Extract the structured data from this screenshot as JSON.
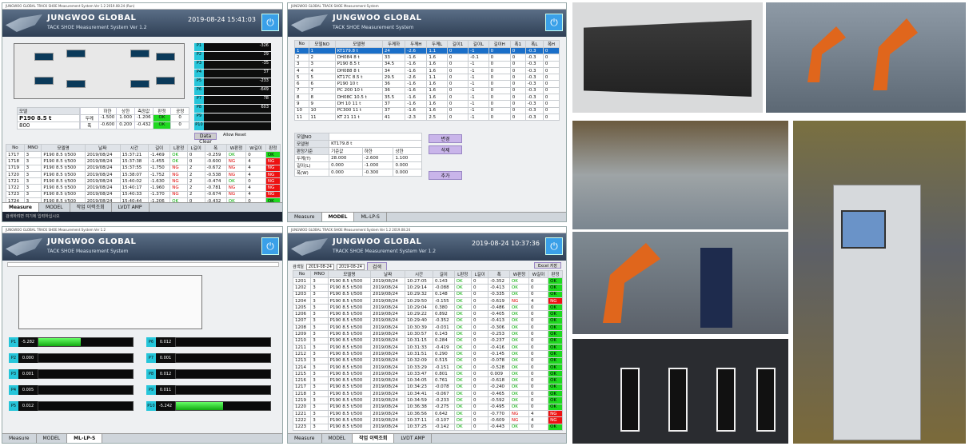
{
  "panel1": {
    "titlebar": "JUNGWOO GLOBAL TRACK SHOE Measurement System Ver 1.2 2019.08.24 (Run)",
    "company": "JUNGWOO GLOBAL",
    "system": "TACK SHOE Measurement System",
    "version": "Ver 1.2",
    "timestamp": "2019-08-24 15:41:03",
    "sensors": [
      {
        "name": "P1",
        "value": "-326"
      },
      {
        "name": "P2",
        "value": "29"
      },
      {
        "name": "P3",
        "value": "-35"
      },
      {
        "name": "P4",
        "value": "37"
      },
      {
        "name": "P5",
        "value": "-233"
      },
      {
        "name": "P6",
        "value": "-649"
      },
      {
        "name": "P7",
        "value": "78"
      },
      {
        "name": "P8",
        "value": "603"
      },
      {
        "name": "P9",
        "value": ""
      },
      {
        "name": "P10",
        "value": ""
      }
    ],
    "model_label": "모델",
    "model": "P190 8.5 t",
    "model_sub": "800",
    "spec_headers": [
      "",
      "하한",
      "상한",
      "측정값",
      "판정",
      "공정"
    ],
    "spec_rows": [
      [
        "두께",
        "-1.500",
        "1.000",
        "-1.206",
        "OK",
        "0"
      ],
      [
        "폭",
        "-0.600",
        "0.200",
        "-0.432",
        "OK",
        "0"
      ]
    ],
    "buttons": [
      "Data Clear",
      "Allow Reset"
    ],
    "headers": [
      "No",
      "MNO",
      "모델명",
      "날짜",
      "시간",
      "길이",
      "L판정",
      "L길이",
      "폭",
      "W판정",
      "W길이",
      "판정"
    ],
    "rows": [
      [
        "1717",
        "3",
        "P190 8.5 t/500",
        "2019/08/24",
        "15:37:21",
        "-1.469",
        "OK",
        "0",
        "-0.259",
        "OK",
        "0",
        "OK"
      ],
      [
        "1718",
        "3",
        "P190 8.5 t/500",
        "2019/08/24",
        "15:37:38",
        "-1.455",
        "OK",
        "0",
        "-0.600",
        "NG",
        "4",
        "NG"
      ],
      [
        "1719",
        "3",
        "P190 8.5 t/500",
        "2019/08/24",
        "15:37:55",
        "-1.750",
        "NG",
        "2",
        "-0.672",
        "NG",
        "4",
        "NG"
      ],
      [
        "1720",
        "3",
        "P190 8.5 t/500",
        "2019/08/24",
        "15:38:07",
        "-1.752",
        "NG",
        "2",
        "-0.538",
        "NG",
        "4",
        "NG"
      ],
      [
        "1721",
        "3",
        "P190 8.5 t/500",
        "2019/08/24",
        "15:40:02",
        "-1.630",
        "NG",
        "2",
        "-0.474",
        "OK",
        "0",
        "NG"
      ],
      [
        "1722",
        "3",
        "P190 8.5 t/500",
        "2019/08/24",
        "15:40:17",
        "-1.960",
        "NG",
        "2",
        "-0.781",
        "NG",
        "4",
        "NG"
      ],
      [
        "1723",
        "3",
        "P190 8.5 t/500",
        "2019/08/24",
        "15:40:33",
        "-1.370",
        "NG",
        "2",
        "-0.674",
        "NG",
        "4",
        "NG"
      ],
      [
        "1724",
        "3",
        "P190 8.5 t/500",
        "2019/08/24",
        "15:40:44",
        "-1.206",
        "OK",
        "0",
        "-0.432",
        "OK",
        "0",
        "OK"
      ]
    ],
    "tabs": [
      "Measure",
      "MODEL",
      "작업 이력조회",
      "LVDT AMP"
    ],
    "taskbar": "검색하려면 여기에 입력하십시오"
  },
  "panel2": {
    "titlebar": "JUNGWOO GLOBAL TRACK SHOE Measurement System",
    "company": "JUNGWOO GLOBAL",
    "system": "TACK SHOE Measurement System",
    "headers": [
      "No",
      "모델NO",
      "모델명",
      "두께하",
      "두께H",
      "두께L",
      "길이1",
      "길이L",
      "길이H",
      "폭1",
      "폭L",
      "폭H"
    ],
    "rows": [
      [
        "1",
        "1",
        "KT179.8 t",
        "24",
        "-2.6",
        "1.1",
        "0",
        "-1",
        "0",
        "0",
        "-0.3",
        "0"
      ],
      [
        "2",
        "2",
        "DH084 8 t",
        "33",
        "-1.6",
        "1.6",
        "0",
        "-0.1",
        "0",
        "0",
        "-0.3",
        "0"
      ],
      [
        "3",
        "3",
        "P190 8.5 t",
        "34.5",
        "-1.6",
        "1.6",
        "0",
        "-1",
        "0",
        "0",
        "-0.3",
        "0"
      ],
      [
        "4",
        "4",
        "DH088 8 t",
        "34",
        "-1.6",
        "1.6",
        "0",
        "-1",
        "0",
        "0",
        "-0.3",
        "0"
      ],
      [
        "5",
        "5",
        "KT17C 8.5 t",
        "29.5",
        "-2.6",
        "1.1",
        "0",
        "-1",
        "0",
        "0",
        "-0.3",
        "0"
      ],
      [
        "6",
        "6",
        "P190 10 t",
        "36",
        "-1.6",
        "1.6",
        "0",
        "-1",
        "0",
        "0",
        "-0.3",
        "0"
      ],
      [
        "7",
        "7",
        "PC 200 10 t",
        "36",
        "-1.6",
        "1.6",
        "0",
        "-1",
        "0",
        "0",
        "-0.3",
        "0"
      ],
      [
        "8",
        "8",
        "DH08C 10.5 t",
        "35.5",
        "-1.6",
        "1.6",
        "0",
        "-1",
        "0",
        "0",
        "-0.3",
        "0"
      ],
      [
        "9",
        "9",
        "DH 10 11 t",
        "37",
        "-1.6",
        "1.6",
        "0",
        "-1",
        "0",
        "0",
        "-0.3",
        "0"
      ],
      [
        "10",
        "10",
        "PC300 11 t",
        "37",
        "-1.6",
        "1.6",
        "0",
        "-1",
        "0",
        "0",
        "-0.3",
        "0"
      ],
      [
        "11",
        "11",
        "KT 21 11 t",
        "41",
        "-2.3",
        "2.5",
        "0",
        "-1",
        "0",
        "0",
        "-0.3",
        "0"
      ]
    ],
    "form": {
      "model_no_label": "모델NO",
      "model_name_label": "모델명",
      "model_name": "KT179.8 t",
      "std_label": "판정기준",
      "col_headers": [
        "기준값",
        "하한",
        "상한"
      ],
      "rows": [
        [
          "두께(T)",
          "28.000",
          "-2.600",
          "1.100"
        ],
        [
          "길이(L)",
          "0.000",
          "-1.000",
          "0.000"
        ],
        [
          "폭(W)",
          "0.000",
          "-0.300",
          "0.000"
        ]
      ]
    },
    "buttons": [
      "변경",
      "삭제",
      "추가"
    ],
    "tabs": [
      "Measure",
      "MODEL",
      "ML-LP-S"
    ]
  },
  "panel3": {
    "titlebar": "JUNGWOO GLOBAL TRACK SHOE Measurement System Ver 1.2",
    "company": "JUNGWOO GLOBAL",
    "system": "TACK SHOE Measurement System",
    "bars": [
      {
        "name": "P1",
        "value": "-5.282",
        "level": 0.45
      },
      {
        "name": "P2",
        "value": "0.000",
        "level": 0
      },
      {
        "name": "P3",
        "value": "0.001",
        "level": 0
      },
      {
        "name": "P4",
        "value": "0.005",
        "level": 0
      },
      {
        "name": "P5",
        "value": "0.012",
        "level": 0
      },
      {
        "name": "P6",
        "value": "0.012",
        "level": 0
      },
      {
        "name": "P7",
        "value": "0.001",
        "level": 0
      },
      {
        "name": "P8",
        "value": "0.012",
        "level": 0
      },
      {
        "name": "P9",
        "value": "0.011",
        "level": 0
      },
      {
        "name": "P10",
        "value": "-5.242",
        "level": 0.5
      }
    ],
    "tabs": [
      "Measure",
      "MODEL",
      "ML-LP-S"
    ]
  },
  "panel4": {
    "titlebar": "JUNGWOO GLOBAL TRACK SHOE Measurement System Ver 1.2 2019.08.24",
    "company": "JUNGWOO GLOBAL",
    "system": "TRACK SHOE Measurement System",
    "version": "Ver 1.2",
    "timestamp": "2019-08-24 10:37:36",
    "search_label": "검색일",
    "date_from": "2019-08-24",
    "date_to": "2019-08-24",
    "search_button": "검색",
    "excel_button": "Excel 저장",
    "headers": [
      "No",
      "MNO",
      "모델명",
      "날짜",
      "시간",
      "길이",
      "L판정",
      "L길이",
      "폭",
      "W판정",
      "W길이",
      "판정"
    ],
    "rows": [
      [
        "1201",
        "3",
        "P190 8.5 t/500",
        "2019/08/24",
        "10:27:05",
        "0.143",
        "OK",
        "0",
        "-0.352",
        "OK",
        "0",
        "OK"
      ],
      [
        "1202",
        "3",
        "P190 8.5 t/500",
        "2019/08/24",
        "10:29:14",
        "-0.088",
        "OK",
        "0",
        "-0.413",
        "OK",
        "0",
        "OK"
      ],
      [
        "1203",
        "3",
        "P190 8.5 t/500",
        "2019/08/24",
        "10:29:32",
        "0.148",
        "OK",
        "0",
        "-0.335",
        "OK",
        "0",
        "OK"
      ],
      [
        "1204",
        "3",
        "P190 8.5 t/500",
        "2019/08/24",
        "10:29:50",
        "-0.155",
        "OK",
        "0",
        "-0.619",
        "NG",
        "4",
        "NG"
      ],
      [
        "1205",
        "3",
        "P190 8.5 t/500",
        "2019/08/24",
        "10:29:04",
        "0.380",
        "OK",
        "0",
        "-0.486",
        "OK",
        "0",
        "OK"
      ],
      [
        "1206",
        "3",
        "P190 8.5 t/500",
        "2019/08/24",
        "10:29:22",
        "0.892",
        "OK",
        "0",
        "-0.405",
        "OK",
        "0",
        "OK"
      ],
      [
        "1207",
        "3",
        "P190 8.5 t/500",
        "2019/08/24",
        "10:29:40",
        "-0.352",
        "OK",
        "0",
        "-0.413",
        "OK",
        "0",
        "OK"
      ],
      [
        "1208",
        "3",
        "P190 8.5 t/500",
        "2019/08/24",
        "10:30:39",
        "-0.031",
        "OK",
        "0",
        "-0.306",
        "OK",
        "0",
        "OK"
      ],
      [
        "1209",
        "3",
        "P190 8.5 t/500",
        "2019/08/24",
        "10:30:57",
        "0.143",
        "OK",
        "0",
        "-0.253",
        "OK",
        "0",
        "OK"
      ],
      [
        "1210",
        "3",
        "P190 8.5 t/500",
        "2019/08/24",
        "10:31:15",
        "0.284",
        "OK",
        "0",
        "-0.237",
        "OK",
        "0",
        "OK"
      ],
      [
        "1211",
        "3",
        "P190 8.5 t/500",
        "2019/08/24",
        "10:31:33",
        "-0.419",
        "OK",
        "0",
        "-0.416",
        "OK",
        "0",
        "OK"
      ],
      [
        "1212",
        "3",
        "P190 8.5 t/500",
        "2019/08/24",
        "10:31:51",
        "0.290",
        "OK",
        "0",
        "-0.145",
        "OK",
        "0",
        "OK"
      ],
      [
        "1213",
        "3",
        "P190 8.5 t/500",
        "2019/08/24",
        "10:32:09",
        "0.515",
        "OK",
        "0",
        "-0.078",
        "OK",
        "0",
        "OK"
      ],
      [
        "1214",
        "3",
        "P190 8.5 t/500",
        "2019/08/24",
        "10:33:29",
        "-0.151",
        "OK",
        "0",
        "-0.528",
        "OK",
        "0",
        "OK"
      ],
      [
        "1215",
        "3",
        "P190 8.5 t/500",
        "2019/08/24",
        "10:33:47",
        "0.801",
        "OK",
        "0",
        "0.009",
        "OK",
        "0",
        "OK"
      ],
      [
        "1216",
        "3",
        "P190 8.5 t/500",
        "2019/08/24",
        "10:34:05",
        "0.761",
        "OK",
        "0",
        "-0.618",
        "OK",
        "0",
        "OK"
      ],
      [
        "1217",
        "3",
        "P190 8.5 t/500",
        "2019/08/24",
        "10:34:23",
        "-0.078",
        "OK",
        "0",
        "-0.240",
        "OK",
        "0",
        "OK"
      ],
      [
        "1218",
        "3",
        "P190 8.5 t/500",
        "2019/08/24",
        "10:34:41",
        "-0.067",
        "OK",
        "0",
        "-0.465",
        "OK",
        "0",
        "OK"
      ],
      [
        "1219",
        "3",
        "P190 8.5 t/500",
        "2019/08/24",
        "10:34:59",
        "-0.233",
        "OK",
        "0",
        "-0.592",
        "OK",
        "0",
        "OK"
      ],
      [
        "1220",
        "3",
        "P190 8.5 t/500",
        "2019/08/24",
        "10:36:38",
        "-0.275",
        "OK",
        "0",
        "-0.495",
        "OK",
        "0",
        "OK"
      ],
      [
        "1221",
        "3",
        "P190 8.5 t/500",
        "2019/08/24",
        "10:36:56",
        "0.642",
        "OK",
        "0",
        "-0.770",
        "NG",
        "4",
        "NG"
      ],
      [
        "1222",
        "3",
        "P190 8.5 t/500",
        "2019/08/24",
        "10:37:11",
        "-0.107",
        "OK",
        "0",
        "-0.609",
        "NG",
        "4",
        "NG"
      ],
      [
        "1223",
        "3",
        "P190 8.5 t/500",
        "2019/08/24",
        "10:37:25",
        "-0.142",
        "OK",
        "0",
        "-0.443",
        "OK",
        "0",
        "OK"
      ]
    ],
    "tabs": [
      "Measure",
      "MODEL",
      "작업 이력조회",
      "LVDT AMP"
    ]
  },
  "colors": {
    "header": "#3b4d66",
    "ok": "#1fd91f",
    "ng": "#e11111",
    "select": "#1a6fc9"
  }
}
